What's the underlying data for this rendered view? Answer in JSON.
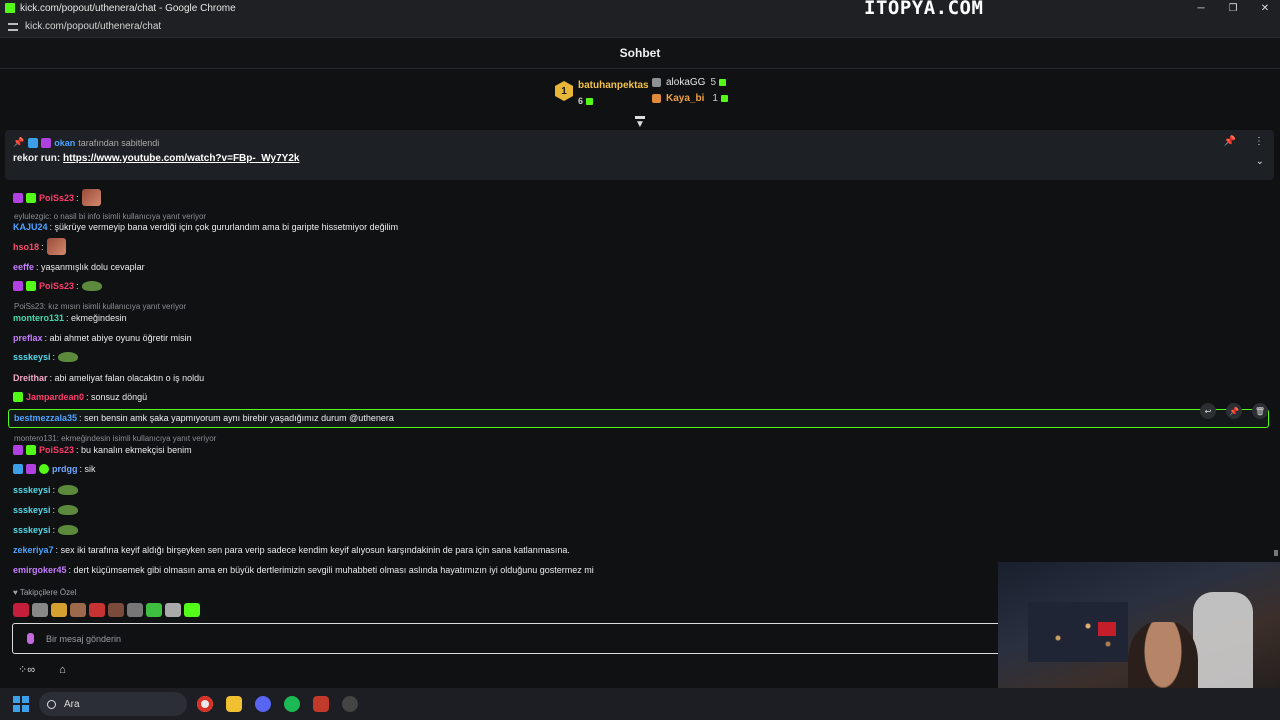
{
  "browser": {
    "window_title": "kick.com/popout/uthenera/chat - Google Chrome",
    "url": "kick.com/popout/uthenera/chat",
    "watermark": "İTOPYA.COM"
  },
  "chat": {
    "title": "Sohbet",
    "leaderboard": {
      "first": {
        "rank": "1",
        "name": "batuhanpektas",
        "count": "6"
      },
      "second": {
        "name": "alokaGG",
        "count": "5"
      },
      "third": {
        "name": "Kaya_bi",
        "count": "1"
      }
    },
    "pinned": {
      "by": "okan",
      "by_suffix": "tarafından sabitlendi",
      "prefix": "rekor run: ",
      "link": "https://www.youtube.com/watch?v=FBp-_Wy7Y2k"
    },
    "messages": [
      {
        "user": "PoiSs23",
        "text": "",
        "color": "#ff3b6b"
      },
      {
        "reply": "eylulezgic: o nasil bi info isimli kullanıcıya yanıt veriyor"
      },
      {
        "user": "KAJU24",
        "text": "şükrüye vermeyip bana verdiği için çok gururlandım ama bi garipte hissetmiyor değilim",
        "color": "#4da3ff"
      },
      {
        "user": "hso18",
        "text": "",
        "color": "#ff4d6d"
      },
      {
        "user": "eeffe",
        "text": "yaşanmışlık dolu cevaplar",
        "color": "#c77dff"
      },
      {
        "user": "PoiSs23",
        "text": "",
        "color": "#ff3b6b"
      },
      {
        "reply": "PoiSs23: kız mısın isimli kullanıcıya yanıt veriyor"
      },
      {
        "user": "montero131",
        "text": "ekmeğindesin",
        "color": "#43d9ad"
      },
      {
        "user": "preflax",
        "text": "abi ahmet abiye oyunu öğretir misin",
        "color": "#c77dff"
      },
      {
        "user": "ssskeysi",
        "text": "",
        "color": "#53d9e8"
      },
      {
        "user": "Dreithar",
        "text": "abi ameliyat falan olacaktın o iş noldu",
        "color": "#f4a7c3"
      },
      {
        "user": "Jampardean0",
        "text": "sonsuz döngü",
        "color": "#ff3b6b"
      },
      {
        "user": "bestmezzala35",
        "text": "sen bensin amk şaka yapmıyorum aynı birebir yaşadığımız durum @uthenera",
        "color": "#4da3ff"
      },
      {
        "reply": "montero131: ekmeğindesin isimli kullanıcıya yanıt veriyor"
      },
      {
        "user": "PoiSs23",
        "text": "bu kanalın ekmekçisi benim",
        "color": "#ff3b6b"
      },
      {
        "user": "prdgg",
        "text": "sik",
        "color": "#6fa8ff"
      },
      {
        "user": "ssskeysi",
        "text": "",
        "color": "#53d9e8"
      },
      {
        "user": "ssskeysi",
        "text": "",
        "color": "#53d9e8"
      },
      {
        "user": "ssskeysi",
        "text": "",
        "color": "#53d9e8"
      },
      {
        "user": "zekeriya7",
        "text": "sex iki tarafına keyif aldığı birşeyken sen para verip sadece kendim keyif alıyosun karşındakinin de para için sana katlanmasına.",
        "color": "#4da3ff"
      },
      {
        "user": "emirgoker45",
        "text": "dert küçümsemek gibi olmasın ama en büyük dertlerimizin sevgili muhabbeti olması aslında hayatımızın iyi olduğunu gostermez mi",
        "color": "#c77dff"
      }
    ],
    "followers_label": "Takipçilere Özel",
    "input_placeholder": "Bir mesaj gönderin"
  },
  "taskbar": {
    "search_label": "Ara"
  },
  "colors": {
    "accent": "#53fc18",
    "gold": "#f4c247"
  }
}
